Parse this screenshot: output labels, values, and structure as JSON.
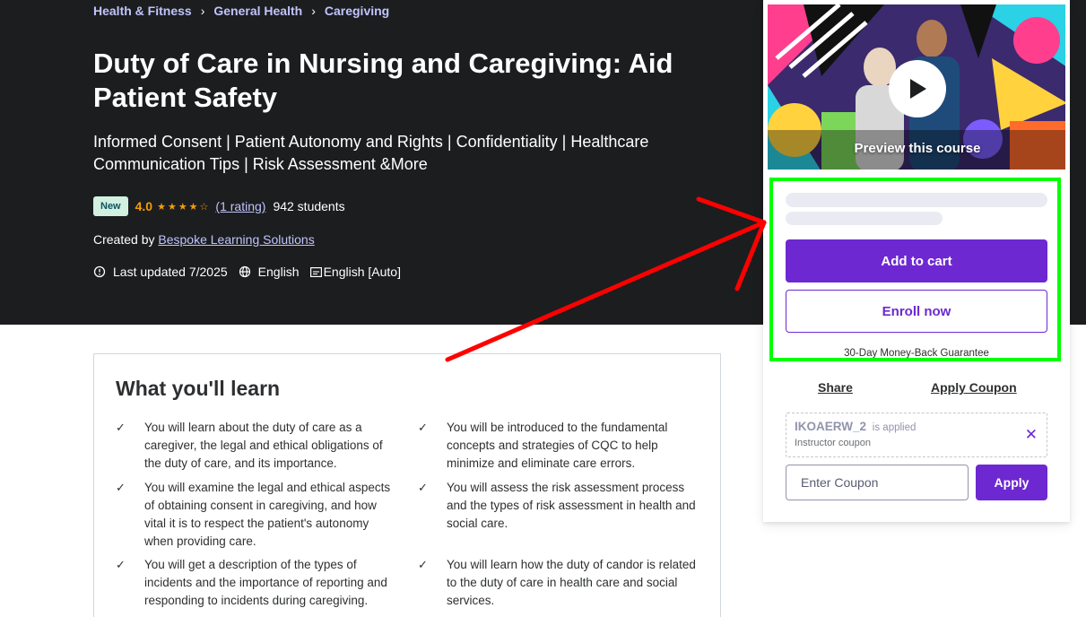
{
  "breadcrumb": [
    "Health & Fitness",
    "General Health",
    "Caregiving"
  ],
  "course": {
    "title": "Duty of Care in Nursing and Caregiving: Aid Patient Safety",
    "subtitle": "Informed Consent | Patient Autonomy and Rights | Confidentiality | Healthcare Communication Tips | Risk Assessment &More",
    "badge": "New",
    "rating": "4.0",
    "stars": "★★★★☆",
    "rating_count": "(1 rating)",
    "students": "942 students",
    "created_by_label": "Created by",
    "instructor": "Bespoke Learning Solutions",
    "last_updated": "Last updated 7/2025",
    "language": "English",
    "captions": "English [Auto]"
  },
  "learn": {
    "title": "What you'll learn",
    "items": [
      "You will learn about the duty of care as a caregiver, the legal and ethical obligations of the duty of care, and its importance.",
      "You will be introduced to the fundamental concepts and strategies of CQC to help minimize and eliminate care errors.",
      "You will examine the legal and ethical aspects of obtaining consent in caregiving, and how vital it is to respect the patient's autonomy when providing care.",
      "You will assess the risk assessment process and the types of risk assessment in health and social care.",
      "You will get a description of the types of incidents and the importance of reporting and responding to incidents during caregiving.",
      "You will learn how the duty of candor is related to the duty of care in health care and social services."
    ]
  },
  "sidebar": {
    "preview_label": "Preview this course",
    "add_to_cart": "Add to cart",
    "enroll_now": "Enroll now",
    "guarantee": "30-Day Money-Back Guarantee",
    "share": "Share",
    "apply_coupon": "Apply Coupon",
    "coupon_code": "IKOAERW_2",
    "coupon_applied": "is applied",
    "coupon_type": "Instructor coupon",
    "coupon_placeholder": "Enter Coupon",
    "apply": "Apply"
  },
  "annotation": {
    "highlight_color": "#00ff00",
    "arrow_color": "#ff0000"
  },
  "colors": {
    "hero_bg": "#1c1d1f",
    "link": "#c0c4fc",
    "accent": "#6d28d2",
    "star": "#f69c08"
  }
}
